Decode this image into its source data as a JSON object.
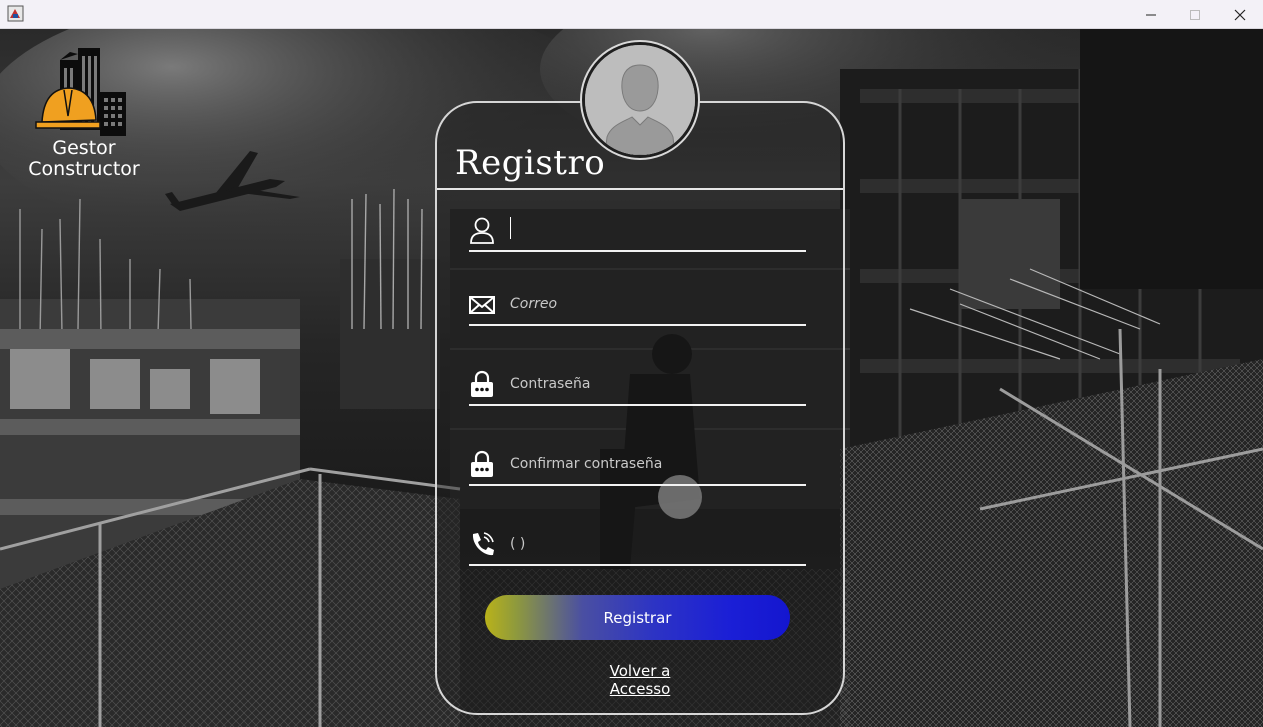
{
  "window": {
    "minimize_label": "—",
    "maximize_label": "☐",
    "close_label": "✕"
  },
  "logo": {
    "line1": "Gestor",
    "line2": "Constructor"
  },
  "form": {
    "title": "Registro",
    "fields": [
      {
        "icon": "user-icon",
        "value": "",
        "placeholder": ""
      },
      {
        "icon": "envelope-icon",
        "placeholder": "Correo"
      },
      {
        "icon": "lock-icon",
        "placeholder": "Contraseña"
      },
      {
        "icon": "lock-icon",
        "placeholder": "Confirmar contraseña"
      },
      {
        "icon": "phone-icon",
        "placeholder": "(  )"
      }
    ],
    "register_button": "Registrar",
    "back_link": "Volver a Accesso"
  },
  "colors": {
    "button_start": "#b9b21a",
    "button_end": "#1416cf",
    "logo_helmet": "#f0a020"
  }
}
